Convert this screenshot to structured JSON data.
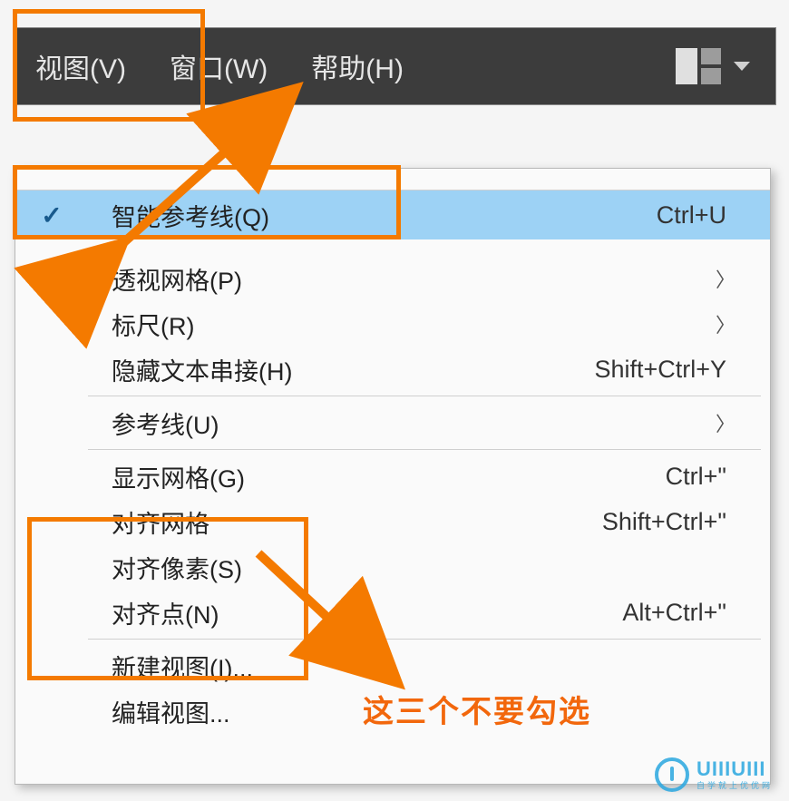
{
  "menubar": {
    "items": [
      {
        "label": "视图(V)"
      },
      {
        "label": "窗口(W)"
      },
      {
        "label": "帮助(H)"
      }
    ]
  },
  "dropdown": {
    "items": [
      {
        "label": "智能参考线(Q)",
        "shortcut": "Ctrl+U",
        "checked": true,
        "selected": true
      },
      {
        "label": "透视网格(P)",
        "shortcut": "",
        "submenu": true
      },
      {
        "label": "标尺(R)",
        "shortcut": "",
        "submenu": true
      },
      {
        "label": "隐藏文本串接(H)",
        "shortcut": "Shift+Ctrl+Y"
      },
      {
        "sep": true
      },
      {
        "label": "参考线(U)",
        "shortcut": "",
        "submenu": true
      },
      {
        "sep": true
      },
      {
        "label": "显示网格(G)",
        "shortcut": "Ctrl+\""
      },
      {
        "label": "对齐网格",
        "shortcut": "Shift+Ctrl+\""
      },
      {
        "label": "对齐像素(S)",
        "shortcut": ""
      },
      {
        "label": "对齐点(N)",
        "shortcut": "Alt+Ctrl+\""
      },
      {
        "sep": true
      },
      {
        "label": "新建视图(I)...",
        "shortcut": ""
      },
      {
        "label": "编辑视图...",
        "shortcut": ""
      }
    ]
  },
  "annotation_text": "这三个不要勾选",
  "watermark": {
    "big": "UIIIUIII",
    "small": "自学就上优优网"
  }
}
